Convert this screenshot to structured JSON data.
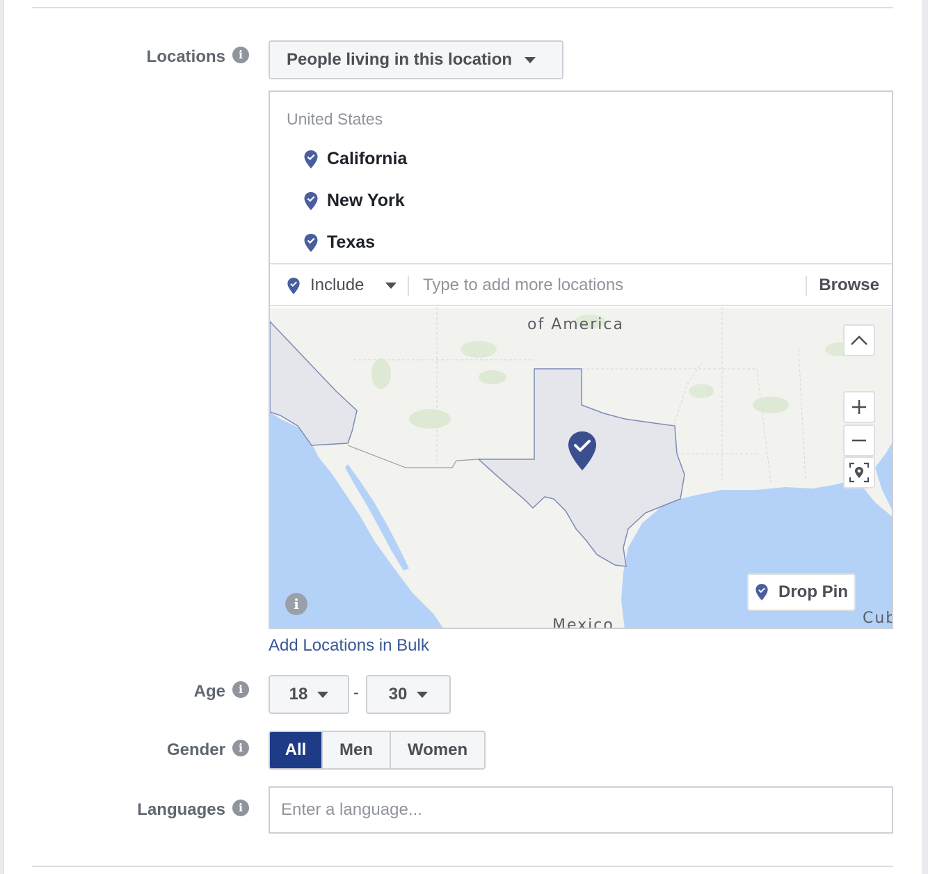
{
  "locations": {
    "label": "Locations",
    "mode_dropdown": "People living in this location",
    "country": "United States",
    "items": [
      "California",
      "New York",
      "Texas"
    ],
    "include_label": "Include",
    "input_placeholder": "Type to add more locations",
    "browse_label": "Browse",
    "map": {
      "labels": [
        "of America",
        "Mexico",
        "Cub"
      ],
      "drop_pin_label": "Drop Pin",
      "controls": [
        "collapse-up",
        "zoom-in",
        "zoom-out",
        "locate"
      ]
    },
    "bulk_link": "Add Locations in Bulk"
  },
  "age": {
    "label": "Age",
    "min": "18",
    "separator": "-",
    "max": "30"
  },
  "gender": {
    "label": "Gender",
    "options": [
      "All",
      "Men",
      "Women"
    ],
    "selected": "All"
  },
  "languages": {
    "label": "Languages",
    "placeholder": "Enter a language..."
  },
  "colors": {
    "accent": "#1d3b87",
    "pin": "#4a5e9e",
    "link": "#385898",
    "water": "#b4d2f7",
    "region": "#e4e6ec"
  }
}
